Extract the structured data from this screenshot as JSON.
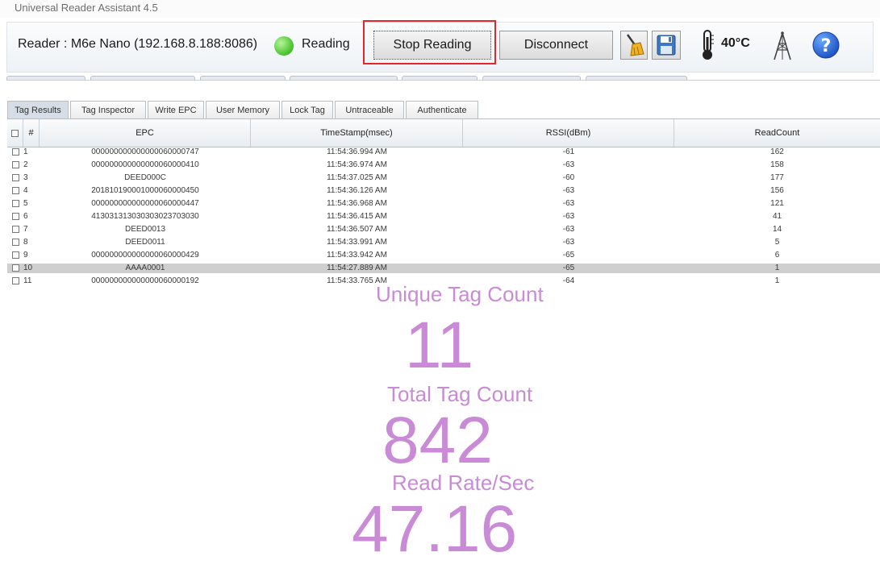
{
  "window": {
    "title": "Universal Reader Assistant 4.5"
  },
  "toolbar": {
    "reader_label": "Reader : M6e Nano (192.168.8.188:8086)",
    "status_text": "Reading",
    "stop_label": "Stop Reading",
    "disconnect_label": "Disconnect",
    "temperature": "40°C",
    "icons": [
      "broom-icon",
      "save-icon",
      "thermometer-icon",
      "antenna-tower-icon",
      "help-icon"
    ]
  },
  "tabs": [
    "Tag Results",
    "Tag Inspector",
    "Write EPC",
    "User Memory",
    "Lock Tag",
    "Untraceable",
    "Authenticate"
  ],
  "table": {
    "columns": [
      "#",
      "EPC",
      "TimeStamp(msec)",
      "RSSI(dBm)",
      "ReadCount"
    ],
    "rows": [
      [
        "1",
        "000000000000000060000747",
        "11:54:36.994 AM",
        "-61",
        "162"
      ],
      [
        "2",
        "000000000000000060000410",
        "11:54:36.974 AM",
        "-63",
        "158"
      ],
      [
        "3",
        "DEED000C",
        "11:54:37.025 AM",
        "-60",
        "177"
      ],
      [
        "4",
        "201810190001000060000450",
        "11:54:36.126 AM",
        "-63",
        "156"
      ],
      [
        "5",
        "000000000000000060000447",
        "11:54:36.968 AM",
        "-63",
        "121"
      ],
      [
        "6",
        "413031313030303023703030",
        "11:54:36.415 AM",
        "-63",
        "41"
      ],
      [
        "7",
        "DEED0013",
        "11:54:36.507 AM",
        "-63",
        "14"
      ],
      [
        "8",
        "DEED0011",
        "11:54:33.991 AM",
        "-63",
        "5"
      ],
      [
        "9",
        "000000000000000060000429",
        "11:54:33.942 AM",
        "-65",
        "6"
      ],
      [
        "10",
        "AAAA0001",
        "11:54:27.889 AM",
        "-65",
        "1"
      ],
      [
        "11",
        "000000000000000060000192",
        "11:54:33.765 AM",
        "-64",
        "1"
      ]
    ],
    "selected_row": "10"
  },
  "stats": {
    "unique_label": "Unique Tag Count",
    "unique_value": "11",
    "total_label": "Total Tag Count",
    "total_value": "842",
    "rate_label": "Read Rate/Sec",
    "rate_value": "47.16"
  },
  "colors": {
    "stats": "#c98bd6",
    "highlight": "#e2262b",
    "status_ok": "#4cc431",
    "help": "#1f66d6"
  }
}
